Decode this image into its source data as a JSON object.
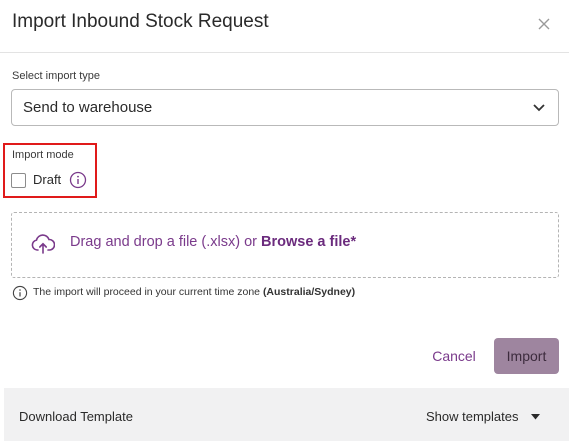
{
  "dialog": {
    "title": "Import Inbound Stock Request",
    "close_icon": "close-icon"
  },
  "import_type": {
    "label": "Select import type",
    "selected": "Send to warehouse"
  },
  "import_mode": {
    "label": "Import mode",
    "draft_label": "Draft",
    "draft_checked": false
  },
  "dropzone": {
    "text_prefix": "Drag and drop a file (.xlsx) or ",
    "browse_link": "Browse a file*"
  },
  "timezone": {
    "text_prefix": "The import will proceed in your current time zone ",
    "zone": "(Australia/Sydney)"
  },
  "actions": {
    "cancel_label": "Cancel",
    "import_label": "Import"
  },
  "footer": {
    "download_template_label": "Download Template",
    "show_templates_label": "Show templates"
  },
  "colors": {
    "accent": "#7a3a8b",
    "import_button": "#9e859f",
    "highlight_border": "#e01a1a",
    "footer_bg": "#f1f1f2"
  }
}
